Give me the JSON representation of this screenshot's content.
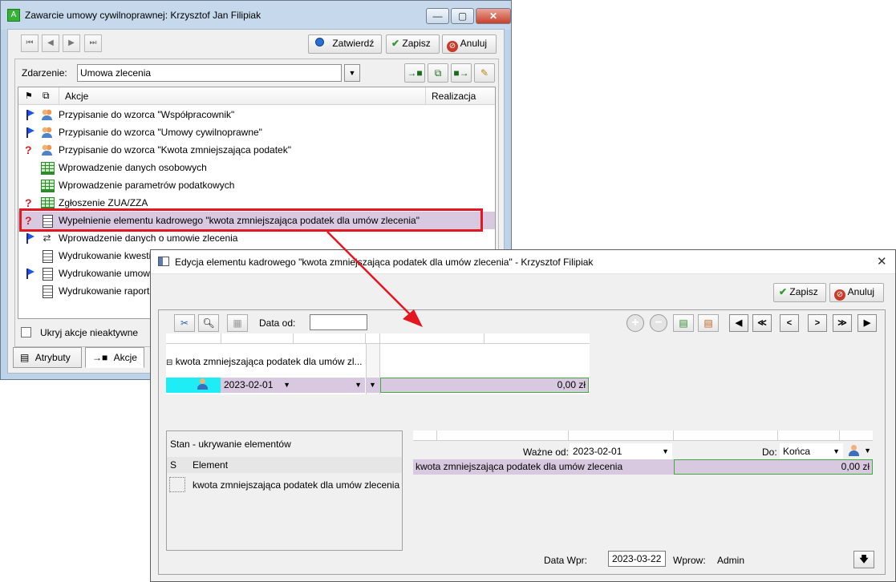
{
  "main_window": {
    "title": "Zawarcie umowy cywilnoprawnej:  Krzysztof Jan Filipiak",
    "window_controls": {
      "minimize": "—",
      "maximize": "▢",
      "close": "✕"
    },
    "toolbar": {
      "nav": [
        "⏮",
        "◀",
        "▶",
        "⏭"
      ],
      "confirm_label": "Zatwierdź",
      "save_label": "Zapisz",
      "cancel_label": "Anuluj"
    },
    "event_label": "Zdarzenie:",
    "event_value": "Umowa zlecenia",
    "columns": {
      "actions": "Akcje",
      "execution": "Realizacja"
    },
    "actions": [
      {
        "status": "flag",
        "icon": "people-icon",
        "label": "Przypisanie do wzorca \"Współpracownik\""
      },
      {
        "status": "flag",
        "icon": "people-icon",
        "label": "Przypisanie do wzorca \"Umowy cywilnoprawne\""
      },
      {
        "status": "question",
        "icon": "people-icon",
        "label": "Przypisanie do wzorca \"Kwota zmniejszająca podatek\""
      },
      {
        "status": "none",
        "icon": "grid-icon",
        "label": "Wprowadzenie danych osobowych"
      },
      {
        "status": "none",
        "icon": "grid-icon",
        "label": "Wprowadzenie parametrów podatkowych"
      },
      {
        "status": "question",
        "icon": "grid-icon",
        "label": "Zgłoszenie ZUA/ZZA"
      },
      {
        "status": "question",
        "icon": "doc-icon",
        "label": "Wypełnienie elementu kadrowego \"kwota zmniejszająca podatek dla umów zlecenia\""
      },
      {
        "status": "flag",
        "icon": "arrows-icon",
        "label": "Wprowadzenie danych o umowie zlecenia"
      },
      {
        "status": "none",
        "icon": "doc-icon",
        "label": "Wydrukowanie kwestionariusza"
      },
      {
        "status": "flag",
        "icon": "doc-icon",
        "label": "Wydrukowanie umowy"
      },
      {
        "status": "none",
        "icon": "doc-icon",
        "label": "Wydrukowanie raportu"
      }
    ],
    "hide_inactive_label": "Ukryj akcje nieaktywne",
    "tabs": [
      "Atrybuty",
      "Akcje"
    ]
  },
  "dialog": {
    "title": "Edycja elementu kadrowego \"kwota zmniejszająca podatek dla umów zlecenia\" - Krzysztof Filipiak",
    "save_label": "Zapisz",
    "cancel_label": "Anuluj",
    "date_from_label": "Data od:",
    "date_from_value": "",
    "tree_group_label": "kwota zmniejszająca podatek dla umów zl...",
    "tree_row": {
      "date": "2023-02-01",
      "amount": "0,00 zł"
    },
    "state_panel_title": "Stan - ukrywanie elementów",
    "state_columns": {
      "s": "S",
      "element": "Element"
    },
    "state_rows": [
      "kwota zmniejszająca podatek dla umów zlecenia"
    ],
    "valid_from_label": "Ważne od:",
    "valid_from_value": "2023-02-01",
    "to_label": "Do:",
    "to_value": "Końca",
    "detail_row": {
      "name": "kwota zmniejszająca podatek dla umów zlecenia",
      "amount": "0,00 zł"
    },
    "entry_date_label": "Data Wpr:",
    "entry_date_value": "2023-03-22",
    "entered_by_label": "Wprow:",
    "entered_by_value": "Admin"
  },
  "colors": {
    "highlight_border": "#e4161f",
    "arrow": "#e4161f",
    "selected_row": "#d9c9e0",
    "active_cell": "#1eedf5"
  }
}
